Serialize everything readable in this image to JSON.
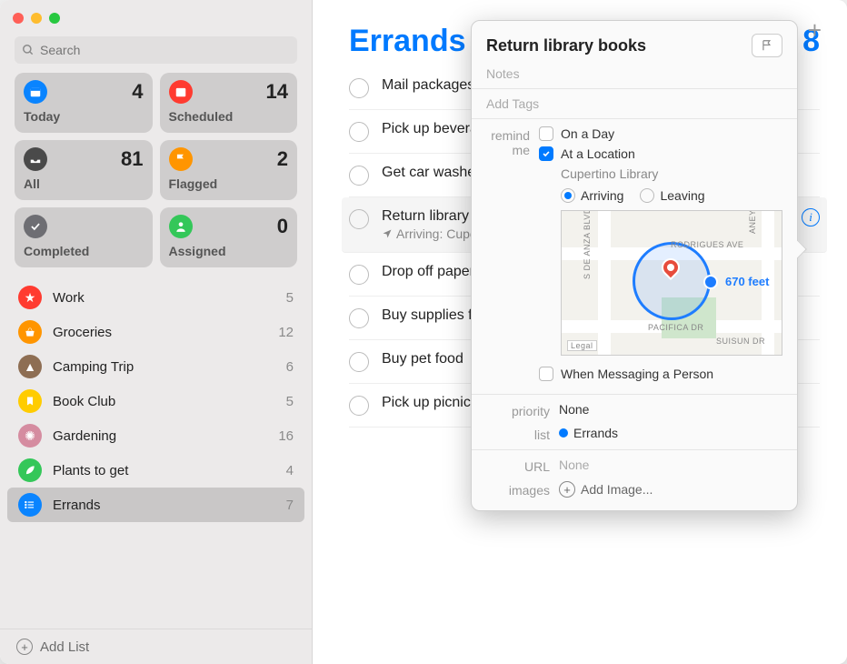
{
  "search": {
    "placeholder": "Search"
  },
  "smart": [
    {
      "label": "Today",
      "count": 4,
      "color": "#0a84ff",
      "icon": "calendar"
    },
    {
      "label": "Scheduled",
      "count": 14,
      "color": "#ff3b30",
      "icon": "calendar"
    },
    {
      "label": "All",
      "count": 81,
      "color": "#4a4a4a",
      "icon": "tray"
    },
    {
      "label": "Flagged",
      "count": 2,
      "color": "#ff9500",
      "icon": "flag"
    },
    {
      "label": "Completed",
      "count": "",
      "color": "#6e6e73",
      "icon": "check"
    },
    {
      "label": "Assigned",
      "count": 0,
      "color": "#34c759",
      "icon": "person"
    }
  ],
  "lists": [
    {
      "name": "Work",
      "count": 5,
      "color": "#ff3b30",
      "icon": "star"
    },
    {
      "name": "Groceries",
      "count": 12,
      "color": "#ff9500",
      "icon": "basket"
    },
    {
      "name": "Camping Trip",
      "count": 6,
      "color": "#8e6e53",
      "icon": "tent"
    },
    {
      "name": "Book Club",
      "count": 5,
      "color": "#ffcc00",
      "icon": "bookmark"
    },
    {
      "name": "Gardening",
      "count": 16,
      "color": "#d58ca0",
      "icon": "sun"
    },
    {
      "name": "Plants to get",
      "count": 4,
      "color": "#34c759",
      "icon": "leaf"
    },
    {
      "name": "Errands",
      "count": 7,
      "color": "#0a84ff",
      "icon": "list",
      "selected": true
    }
  ],
  "addlist_label": "Add List",
  "main": {
    "title": "Errands",
    "count": 8,
    "items": [
      {
        "title": "Mail packages"
      },
      {
        "title": "Pick up beverages"
      },
      {
        "title": "Get car washed"
      },
      {
        "title": "Return library books",
        "sub": "Arriving: Cupertino Library",
        "selected": true
      },
      {
        "title": "Drop off paperwork"
      },
      {
        "title": "Buy supplies for party"
      },
      {
        "title": "Buy pet food"
      },
      {
        "title": "Pick up picnic"
      }
    ]
  },
  "inspector": {
    "title": "Return library books",
    "notes_placeholder": "Notes",
    "tags_placeholder": "Add Tags",
    "remind_label": "remind me",
    "on_day_label": "On a Day",
    "at_location_label": "At a Location",
    "location_name": "Cupertino Library",
    "arriving_label": "Arriving",
    "leaving_label": "Leaving",
    "distance_label": "670 feet",
    "messaging_label": "When Messaging a Person",
    "priority_label": "priority",
    "priority_value": "None",
    "list_label": "list",
    "list_value": "Errands",
    "url_label": "URL",
    "url_value": "None",
    "images_label": "images",
    "add_image_label": "Add Image...",
    "map_labels": {
      "de_anza": "S DE ANZA BLVD",
      "rodrigues": "RODRIGUES AVE",
      "pacifica": "PACIFICA DR",
      "suisun": "SUISUN DR",
      "aney": "ANEY AVE",
      "legal": "Legal"
    }
  }
}
